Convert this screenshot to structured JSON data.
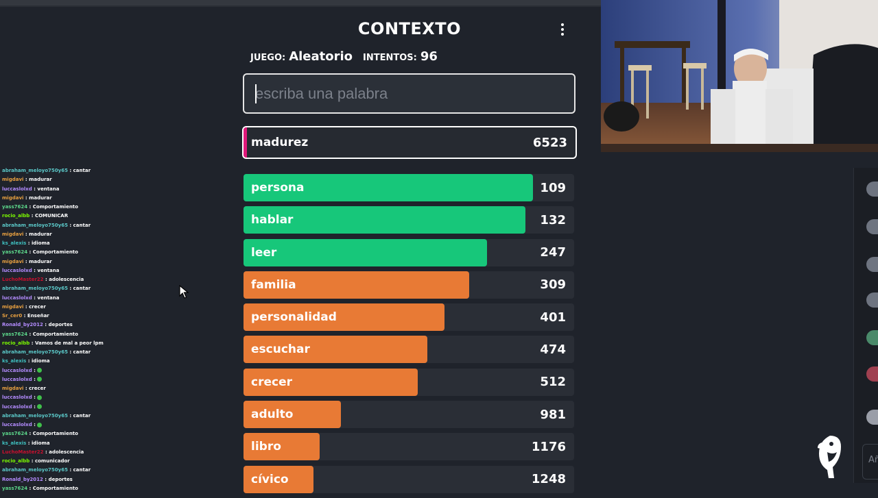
{
  "game": {
    "title": "CONTEXTO",
    "game_label": "JUEGO:",
    "game_value": "Aleatorio",
    "attempts_label": "INTENTOS:",
    "attempts_value": "96",
    "input_placeholder": "escriba una palabra",
    "last_guess": {
      "word": "madurez",
      "rank": "6523"
    },
    "guesses": [
      {
        "word": "persona",
        "rank": "109",
        "fill": 0.876,
        "color": "#17c77a"
      },
      {
        "word": "hablar",
        "rank": "132",
        "fill": 0.852,
        "color": "#17c77a"
      },
      {
        "word": "leer",
        "rank": "247",
        "fill": 0.736,
        "color": "#17c77a"
      },
      {
        "word": "familia",
        "rank": "309",
        "fill": 0.682,
        "color": "#e87a35"
      },
      {
        "word": "personalidad",
        "rank": "401",
        "fill": 0.607,
        "color": "#e87a35"
      },
      {
        "word": "escuchar",
        "rank": "474",
        "fill": 0.555,
        "color": "#e87a35"
      },
      {
        "word": "crecer",
        "rank": "512",
        "fill": 0.527,
        "color": "#e87a35"
      },
      {
        "word": "adulto",
        "rank": "981",
        "fill": 0.295,
        "color": "#e87a35"
      },
      {
        "word": "libro",
        "rank": "1176",
        "fill": 0.23,
        "color": "#e87a35"
      },
      {
        "word": "cívico",
        "rank": "1248",
        "fill": 0.211,
        "color": "#e87a35"
      }
    ]
  },
  "chat": [
    {
      "user": "abraham_meloyo750y65",
      "color": "#5bc8c8",
      "msg": "cantar"
    },
    {
      "user": "migdavi",
      "color": "#e8a040",
      "msg": "madurar"
    },
    {
      "user": "luccaslolxd",
      "color": "#b48cff",
      "msg": "ventana"
    },
    {
      "user": "migdavi",
      "color": "#e8a040",
      "msg": "madurar"
    },
    {
      "user": "yass7624",
      "color": "#5cd68a",
      "msg": "Comportamiento"
    },
    {
      "user": "rocio_albb",
      "color": "#7cfc00",
      "msg": "COMUNICAR"
    },
    {
      "user": "abraham_meloyo750y65",
      "color": "#5bc8c8",
      "msg": "cantar"
    },
    {
      "user": "migdavi",
      "color": "#e8a040",
      "msg": "madurar"
    },
    {
      "user": "ks_alexis",
      "color": "#3fbfbf",
      "msg": "idioma"
    },
    {
      "user": "yass7624",
      "color": "#5cd68a",
      "msg": "Comportamiento"
    },
    {
      "user": "migdavi",
      "color": "#e8a040",
      "msg": "madurar"
    },
    {
      "user": "luccaslolxd",
      "color": "#b48cff",
      "msg": "ventana"
    },
    {
      "user": "LuchoMaster22",
      "color": "#c8102e",
      "msg": "adolescencia"
    },
    {
      "user": "abraham_meloyo750y65",
      "color": "#5bc8c8",
      "msg": "cantar"
    },
    {
      "user": "luccaslolxd",
      "color": "#b48cff",
      "msg": "ventana"
    },
    {
      "user": "migdavi",
      "color": "#e8a040",
      "msg": "crecer"
    },
    {
      "user": "Sr_cer0",
      "color": "#e8a040",
      "msg": "Enseñar"
    },
    {
      "user": "Ronald_by2012",
      "color": "#b48cff",
      "msg": "deportes"
    },
    {
      "user": "yass7624",
      "color": "#5cd68a",
      "msg": "Comportamiento"
    },
    {
      "user": "rocio_albb",
      "color": "#7cfc00",
      "msg": "Vamos de mal a peor lpm"
    },
    {
      "user": "abraham_meloyo750y65",
      "color": "#5bc8c8",
      "msg": "cantar"
    },
    {
      "user": "ks_alexis",
      "color": "#3fbfbf",
      "msg": "idioma"
    },
    {
      "user": "luccaslolxd",
      "color": "#b48cff",
      "msg": "",
      "emote": true
    },
    {
      "user": "luccaslolxd",
      "color": "#b48cff",
      "msg": "",
      "emote": true
    },
    {
      "user": "migdavi",
      "color": "#e8a040",
      "msg": "crecer"
    },
    {
      "user": "luccaslolxd",
      "color": "#b48cff",
      "msg": "",
      "emote": true
    },
    {
      "user": "luccaslolxd",
      "color": "#b48cff",
      "msg": "",
      "emote": true
    },
    {
      "user": "abraham_meloyo750y65",
      "color": "#5bc8c8",
      "msg": "cantar"
    },
    {
      "user": "luccaslolxd",
      "color": "#b48cff",
      "msg": "",
      "emote": true
    },
    {
      "user": "yass7624",
      "color": "#5cd68a",
      "msg": "Comportamiento"
    },
    {
      "user": "ks_alexis",
      "color": "#3fbfbf",
      "msg": "idioma"
    },
    {
      "user": "LuchoMaster22",
      "color": "#c8102e",
      "msg": "adolescencia"
    },
    {
      "user": "rocio_albb",
      "color": "#7cfc00",
      "msg": "comunicador"
    },
    {
      "user": "abraham_meloyo750y65",
      "color": "#5bc8c8",
      "msg": "cantar"
    },
    {
      "user": "Ronald_by2012",
      "color": "#b48cff",
      "msg": "deportes"
    },
    {
      "user": "yass7624",
      "color": "#5cd68a",
      "msg": "Comportamiento"
    }
  ],
  "rail": {
    "input_hint": "Añ"
  }
}
